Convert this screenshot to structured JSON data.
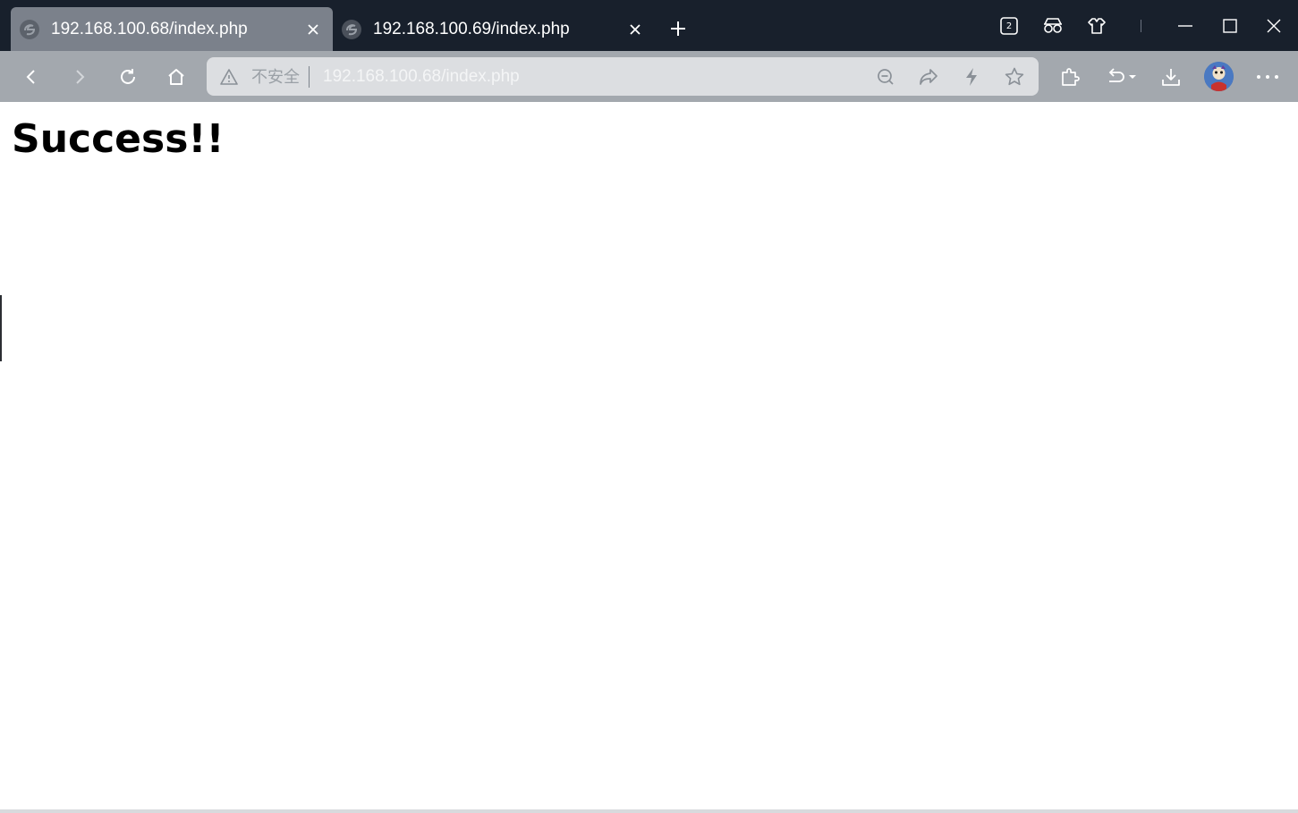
{
  "tabs": [
    {
      "title": "192.168.100.68/index.php",
      "active": true
    },
    {
      "title": "192.168.100.69/index.php",
      "active": false
    }
  ],
  "titlebar": {
    "tab_count_badge": "2",
    "icons": [
      "tab-actions-icon",
      "browser-essentials-icon",
      "extensions-icon",
      "minimize-icon",
      "maximize-icon",
      "close-window-icon"
    ]
  },
  "address_bar": {
    "security_label": "不安全",
    "url": "192.168.100.68/index.php"
  },
  "page": {
    "heading": "Success!!"
  },
  "colors": {
    "titlebar_bg": "#18202c",
    "active_tab_bg": "#7b818b",
    "toolbar_bg": "#a3a8ae",
    "address_bg": "#dcdee1"
  }
}
